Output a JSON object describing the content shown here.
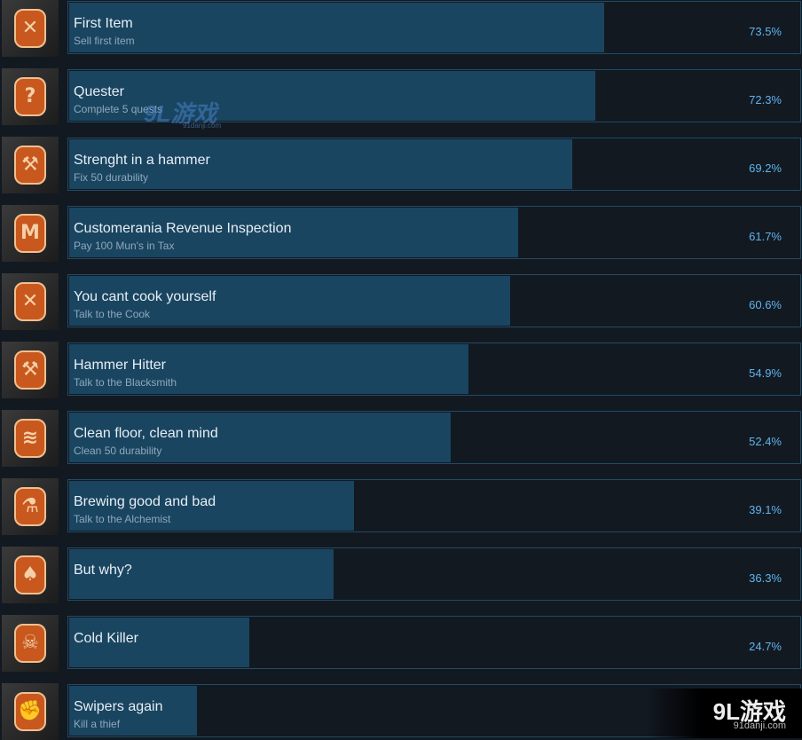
{
  "achievements": [
    {
      "title": "First Item",
      "desc": "Sell first item",
      "percent": 73.5,
      "percent_label": "73.5%",
      "icon": "potion-bottle-icon",
      "glyph": "✕"
    },
    {
      "title": "Quester",
      "desc": "Complete 5 quests",
      "percent": 72.3,
      "percent_label": "72.3%",
      "icon": "quest-scroll-icon",
      "glyph": "?"
    },
    {
      "title": "Strenght in a hammer",
      "desc": "Fix 50 durability",
      "percent": 69.2,
      "percent_label": "69.2%",
      "icon": "hammer-icon",
      "glyph": "⚒"
    },
    {
      "title": "Customerania Revenue Inspection",
      "desc": "Pay 100 Mun's in Tax",
      "percent": 61.7,
      "percent_label": "61.7%",
      "icon": "money-bag-icon",
      "glyph": "M"
    },
    {
      "title": "You cant cook yourself",
      "desc": "Talk to the Cook",
      "percent": 60.6,
      "percent_label": "60.6%",
      "icon": "chef-hat-icon",
      "glyph": "✕"
    },
    {
      "title": "Hammer Hitter",
      "desc": "Talk to the Blacksmith",
      "percent": 54.9,
      "percent_label": "54.9%",
      "icon": "anvil-icon",
      "glyph": "⚒"
    },
    {
      "title": "Clean floor, clean mind",
      "desc": "Clean 50 durability",
      "percent": 52.4,
      "percent_label": "52.4%",
      "icon": "broom-icon",
      "glyph": "≋"
    },
    {
      "title": "Brewing good and bad",
      "desc": "Talk to the Alchemist",
      "percent": 39.1,
      "percent_label": "39.1%",
      "icon": "flask-icon",
      "glyph": "⚗"
    },
    {
      "title": "But why?",
      "desc": "",
      "percent": 36.3,
      "percent_label": "36.3%",
      "icon": "burning-tree-icon",
      "glyph": "♠"
    },
    {
      "title": "Cold Killer",
      "desc": "",
      "percent": 24.7,
      "percent_label": "24.7%",
      "icon": "fallen-body-icon",
      "glyph": "☠"
    },
    {
      "title": "Swipers again",
      "desc": "Kill a thief",
      "percent": 17.6,
      "percent_label": "",
      "icon": "fist-flames-icon",
      "glyph": "✊"
    }
  ],
  "watermark": {
    "logo": "9L游戏",
    "url": "91danji.com"
  },
  "colors": {
    "background": "#121921",
    "bar": "#1a4560",
    "border": "#234a66",
    "percent_text": "#5fb4ee"
  }
}
